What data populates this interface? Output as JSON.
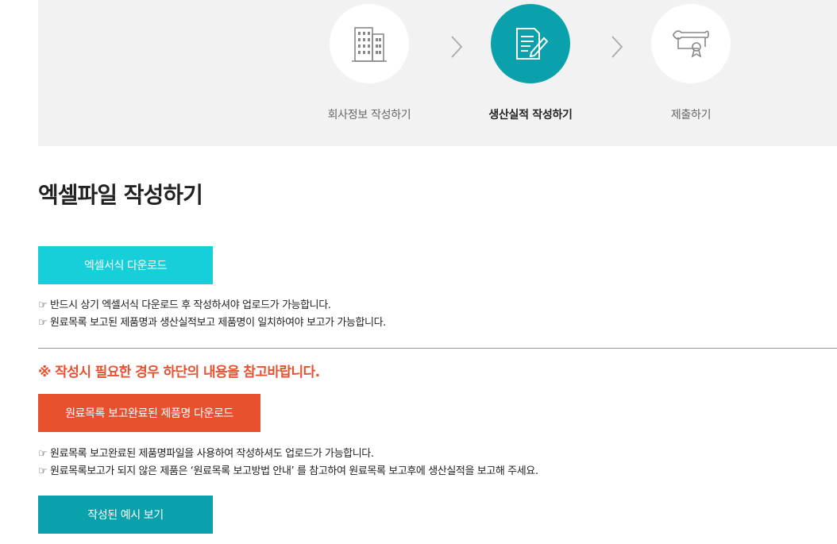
{
  "steps": [
    {
      "label": "회사정보 작성하기",
      "icon": "building-icon",
      "state": "done"
    },
    {
      "label": "생산실적 작성하기",
      "icon": "document-edit-icon",
      "state": "active"
    },
    {
      "label": "제출하기",
      "icon": "diploma-icon",
      "state": "pending"
    }
  ],
  "main": {
    "title": "엑셀파일 작성하기",
    "excel_download_label": "엑셀서식 다운로드",
    "notes1": [
      "☞ 반드시 상기 엑셀서식 다운로드 후 작성하셔야 업로드가 가능합니다.",
      "☞ 원료목록 보고된 제품명과 생산실적보고 제품명이 일치하여야 보고가 가능합니다."
    ],
    "warning": "※ 작성시 필요한 경우 하단의 내용을 참고바랍니다.",
    "product_download_label": "원료목록 보고완료된 제품명 다운로드",
    "notes2": [
      "☞ 원료목록 보고완료된 제품명파일을 사용하여 작성하셔도 업로드가 가능합니다.",
      "☞ 원료목록보고가 되지 않은 제품은 ‘원료목록 보고방법 안내’ 를 참고하여 원료목록 보고후에 생산실적을 보고해 주세요."
    ],
    "example_label": "작성된 예시 보기"
  },
  "colors": {
    "active_step": "#0aa1ad",
    "excel_button": "#17cfd8",
    "warning": "#e8512f",
    "example_button": "#0aa1ad"
  }
}
